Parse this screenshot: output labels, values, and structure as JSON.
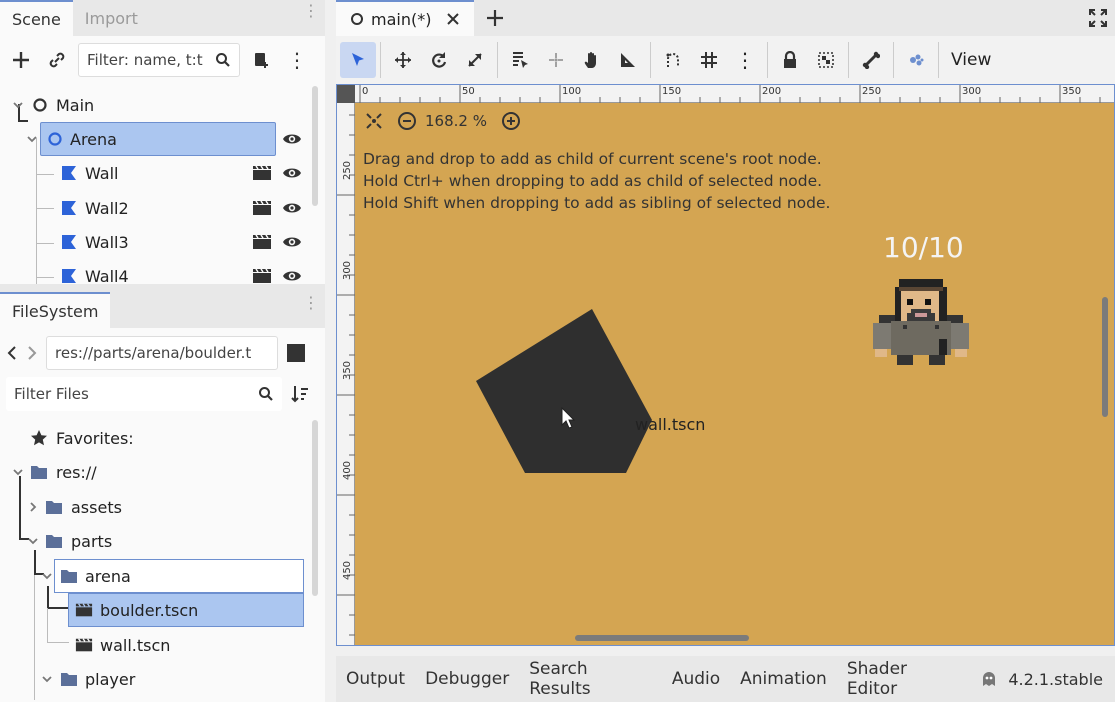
{
  "scene_dock": {
    "tabs": [
      "Scene",
      "Import"
    ],
    "filter_placeholder": "Filter: name, t:t",
    "tree": [
      {
        "label": "Main"
      },
      {
        "label": "Arena"
      },
      {
        "label": "Wall"
      },
      {
        "label": "Wall2"
      },
      {
        "label": "Wall3"
      },
      {
        "label": "Wall4"
      }
    ]
  },
  "filesystem_dock": {
    "tab": "FileSystem",
    "path": "res://parts/arena/boulder.t",
    "filter_placeholder": "Filter Files",
    "tree": [
      {
        "label": "Favorites:"
      },
      {
        "label": "res://"
      },
      {
        "label": "assets"
      },
      {
        "label": "parts"
      },
      {
        "label": "arena"
      },
      {
        "label": "boulder.tscn"
      },
      {
        "label": "wall.tscn"
      },
      {
        "label": "player"
      }
    ]
  },
  "editor": {
    "tab_title": "main(*)",
    "view_menu": "View",
    "zoom": "168.2 %",
    "hints": [
      "Drag and drop to add as child of current scene's root node.",
      "Hold Ctrl+ when dropping to add as child of selected node.",
      "Hold Shift when dropping to add as sibling of selected node."
    ],
    "health_label": "10/10",
    "drag_label": "wall.tscn",
    "ruler_top": [
      "0",
      "50",
      "100",
      "150",
      "200",
      "250",
      "300",
      "350"
    ],
    "ruler_left": [
      "250",
      "300",
      "350",
      "400",
      "450"
    ]
  },
  "bottom_panel": {
    "tabs": [
      "Output",
      "Debugger",
      "Search Results",
      "Audio",
      "Animation",
      "Shader Editor"
    ],
    "version": "4.2.1.stable"
  },
  "colors": {
    "accent": "#6d8fcf",
    "viewport_bg": "#d4a552",
    "node_icon_blue": "#2d63d8",
    "folder_icon": "#5b6f99"
  }
}
